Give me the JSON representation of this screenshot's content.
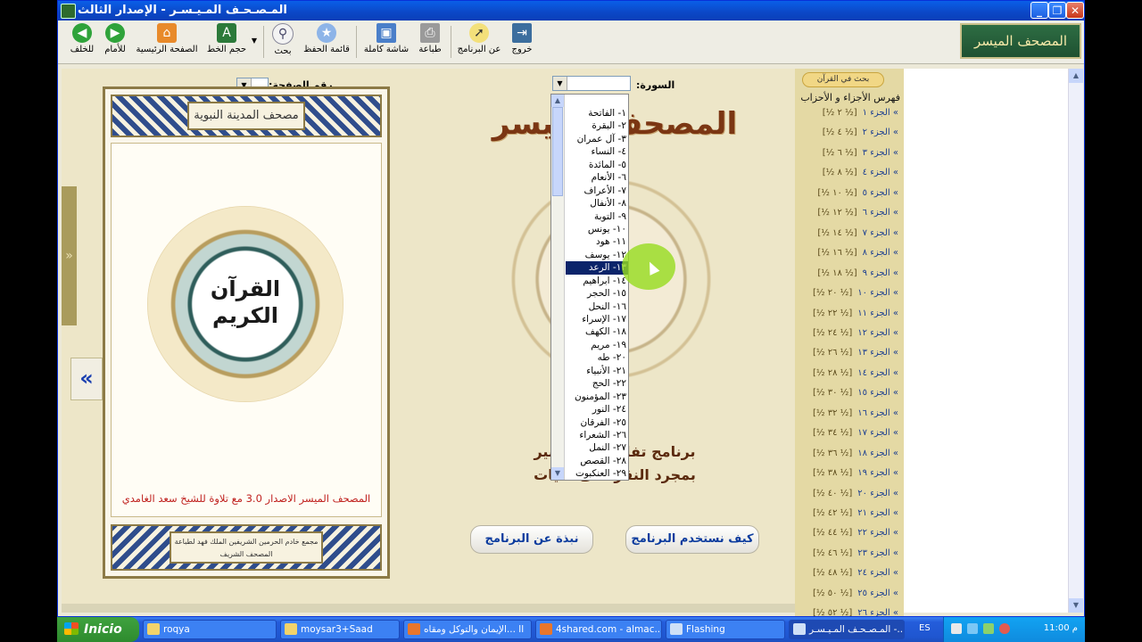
{
  "window": {
    "title": "المـصـحـف المـيـسـر - الإصدار الثالث",
    "controls": {
      "minimize": "_",
      "maximize": "❐",
      "close": "✕"
    }
  },
  "toolbar": {
    "back_label": "للخلف",
    "forward_label": "للأمام",
    "home_label": "الصفحة الرئيسية",
    "font_size_label": "حجم الخط",
    "search_label": "بحث",
    "bookmarks_label": "قائمة الحفظ",
    "fullscreen_label": "شاشة كاملة",
    "print_label": "طباعة",
    "about_label": "عن البرنامج",
    "exit_label": "خروج"
  },
  "logo_text": "المصحف الميسر",
  "left_page": {
    "page_number_label": "رقم الصفحة:",
    "page_number_value": "",
    "cover_header": "مصحف المدينة النبوية",
    "cover_center": "القرآن الكريم",
    "cover_caption": "المصحف الميسر الاصدار 3.0 مع تلاوة للشيخ سعد الغامدي",
    "cover_footer": "مجمع خادم الحرمين الشريفين الملك فهد لطباعة المصحف الشريف",
    "collapse_arrow": "»",
    "nav_arrow": "«"
  },
  "middle_page": {
    "surah_label": "السورة:",
    "title": "المصحف الميسر",
    "line1": "برنامج تفاعلي للتفسير",
    "line2": "بمجرد النقر على الآيات",
    "how_to_button": "كيف نستخدم البرنامج",
    "about_button": "نبذة عن البرنامج"
  },
  "surah_dropdown": {
    "items": [
      "١- الفاتحة",
      "٢- البقرة",
      "٣- آل عمران",
      "٤- النساء",
      "٥- المائدة",
      "٦- الأنعام",
      "٧- الأعراف",
      "٨- الأنفال",
      "٩- التوبة",
      "١٠- يونس",
      "١١- هود",
      "١٢- يوسف",
      "١٣- الرعد",
      "١٤- ابراهيم",
      "١٥- الحجر",
      "١٦- النحل",
      "١٧- الإسراء",
      "١٨- الكهف",
      "١٩- مريم",
      "٢٠- طه",
      "٢١- الأنبياء",
      "٢٢- الحج",
      "٢٣- المؤمنون",
      "٢٤- النور",
      "٢٥- الفرقان",
      "٢٦- الشعراء",
      "٢٧- النمل",
      "٢٨- القصص",
      "٢٩- العنكبوت"
    ],
    "selected_index": 12
  },
  "index_panel": {
    "search_button": "بحث في القرآن",
    "title": "فهرس الأجزاء و الأحزاب",
    "rows": [
      {
        "part": "» الجزء ١",
        "marks": "[½ ٢ ½]"
      },
      {
        "part": "» الجزء ٢",
        "marks": "[½ ٤ ½]"
      },
      {
        "part": "» الجزء ٣",
        "marks": "[½ ٦ ½]"
      },
      {
        "part": "» الجزء ٤",
        "marks": "[½ ٨ ½]"
      },
      {
        "part": "» الجزء ٥",
        "marks": "[½ ١٠ ½]"
      },
      {
        "part": "» الجزء ٦",
        "marks": "[½ ١٢ ½]"
      },
      {
        "part": "» الجزء ٧",
        "marks": "[½ ١٤ ½]"
      },
      {
        "part": "» الجزء ٨",
        "marks": "[½ ١٦ ½]"
      },
      {
        "part": "» الجزء ٩",
        "marks": "[½ ١٨ ½]"
      },
      {
        "part": "» الجزء ١٠",
        "marks": "[½ ٢٠ ½]"
      },
      {
        "part": "» الجزء ١١",
        "marks": "[½ ٢٢ ½]"
      },
      {
        "part": "» الجزء ١٢",
        "marks": "[½ ٢٤ ½]"
      },
      {
        "part": "» الجزء ١٣",
        "marks": "[½ ٢٦ ½]"
      },
      {
        "part": "» الجزء ١٤",
        "marks": "[½ ٢٨ ½]"
      },
      {
        "part": "» الجزء ١٥",
        "marks": "[½ ٣٠ ½]"
      },
      {
        "part": "» الجزء ١٦",
        "marks": "[½ ٣٢ ½]"
      },
      {
        "part": "» الجزء ١٧",
        "marks": "[½ ٣٤ ½]"
      },
      {
        "part": "» الجزء ١٨",
        "marks": "[½ ٣٦ ½]"
      },
      {
        "part": "» الجزء ١٩",
        "marks": "[½ ٣٨ ½]"
      },
      {
        "part": "» الجزء ٢٠",
        "marks": "[½ ٤٠ ½]"
      },
      {
        "part": "» الجزء ٢١",
        "marks": "[½ ٤٢ ½]"
      },
      {
        "part": "» الجزء ٢٢",
        "marks": "[½ ٤٤ ½]"
      },
      {
        "part": "» الجزء ٢٣",
        "marks": "[½ ٤٦ ½]"
      },
      {
        "part": "» الجزء ٢٤",
        "marks": "[½ ٤٨ ½]"
      },
      {
        "part": "» الجزء ٢٥",
        "marks": "[½ ٥٠ ½]"
      },
      {
        "part": "» الجزء ٢٦",
        "marks": "[½ ٥٢ ½]"
      }
    ]
  },
  "taskbar": {
    "start_label": "Inicio",
    "tasks": [
      {
        "label": "roqya",
        "icon": "folder-icon"
      },
      {
        "label": "moysar3+Saad",
        "icon": "folder-icon"
      },
      {
        "label": "الإيمان والتوكل ومقاه... ll",
        "icon": "firefox-icon"
      },
      {
        "label": "4shared.com - almac...",
        "icon": "firefox-icon"
      },
      {
        "label": "Flashing",
        "icon": "app-icon"
      },
      {
        "label": "المـصـحـف المـيـسـر -...",
        "icon": "app-icon"
      }
    ],
    "language": "ES",
    "clock": "11:00 م"
  },
  "colors": {
    "titlebar": "#0A4FD6",
    "index_bg": "#E4D9A4",
    "page_bg": "#EDE6C8",
    "title_brown": "#7B3613",
    "selected": "#0B246A"
  }
}
